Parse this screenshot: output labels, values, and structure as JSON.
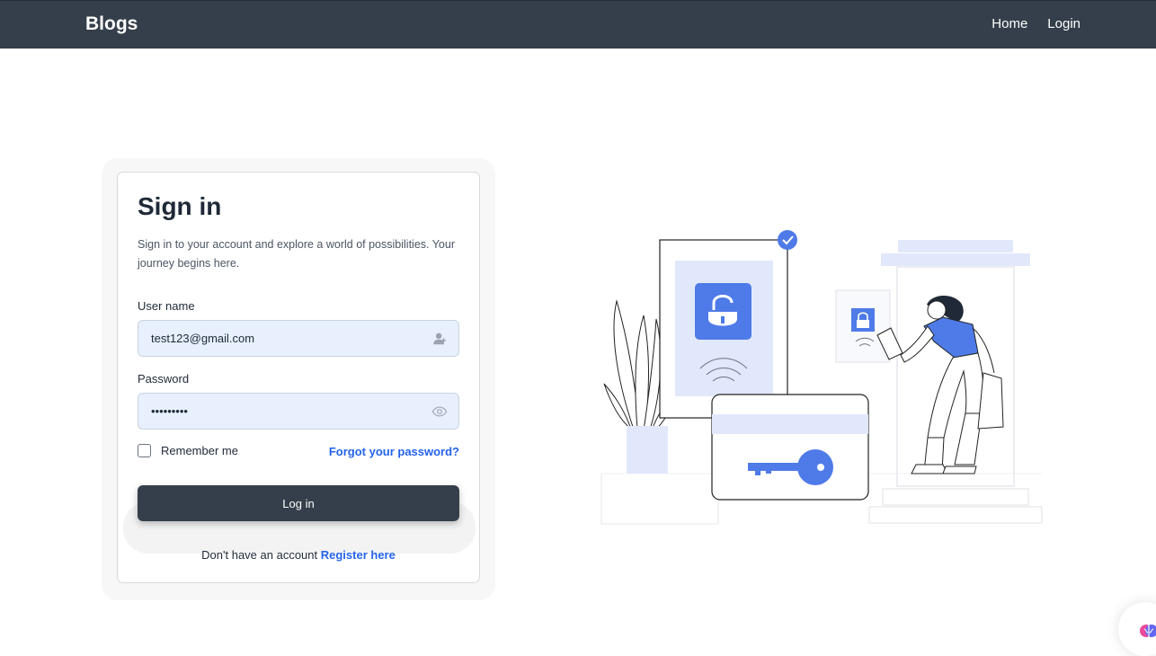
{
  "navbar": {
    "brand": "Blogs",
    "links": [
      {
        "label": "Home"
      },
      {
        "label": "Login"
      }
    ]
  },
  "signin": {
    "title": "Sign in",
    "subtitle": "Sign in to your account and explore a world of possibilities. Your journey begins here.",
    "username_label": "User name",
    "username_value": "test123@gmail.com",
    "password_label": "Password",
    "password_value": "password1",
    "remember_label": "Remember me",
    "forgot_label": "Forgot your password?",
    "login_label": "Log in",
    "register_prompt": "Don't have an account",
    "register_link": "Register here"
  },
  "icons": {
    "username": "user-plus-icon",
    "password": "eye-icon",
    "widget": "brain-icon"
  },
  "colors": {
    "navbar": "#343f4b",
    "accent": "#2563eb",
    "illustration_accent": "#4f7be8",
    "illustration_light": "#e2e8fb",
    "field_bg": "#e8f0fe"
  }
}
